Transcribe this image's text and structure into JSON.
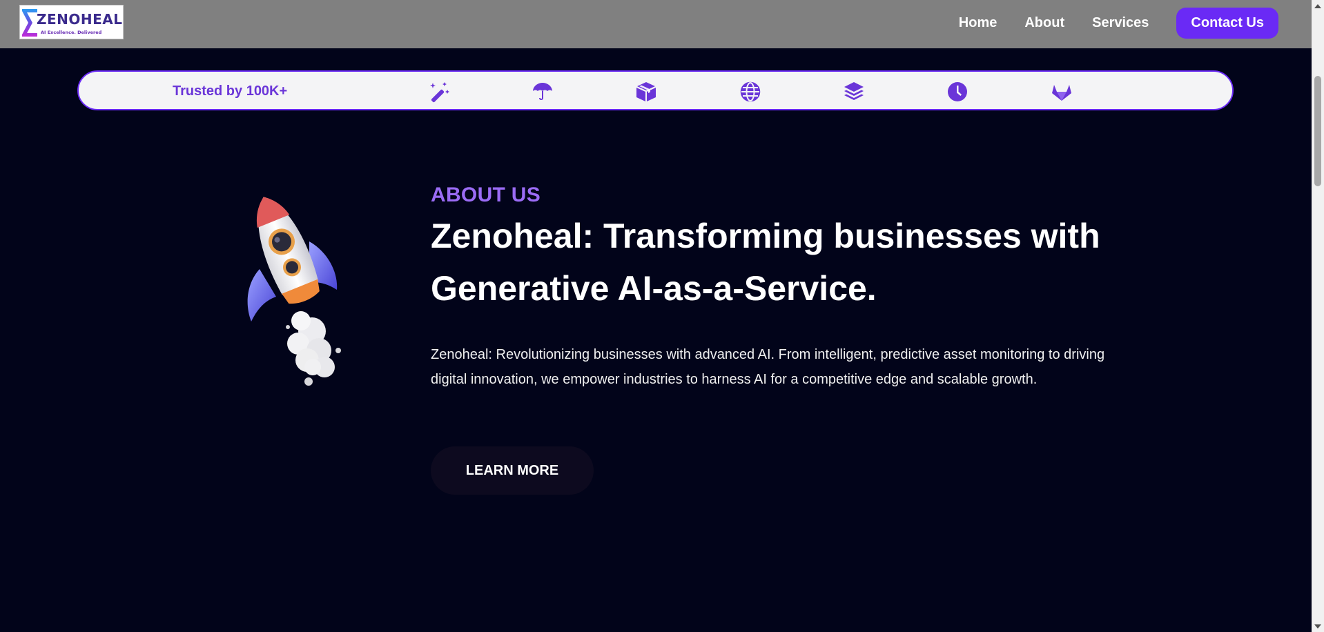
{
  "header": {
    "logo": {
      "brand": "ZENOHEAL",
      "tagline": "AI Excellence. Delivered"
    },
    "nav": [
      {
        "label": "Home"
      },
      {
        "label": "About"
      },
      {
        "label": "Services"
      }
    ],
    "contact_label": "Contact Us"
  },
  "trusted": {
    "text": "Trusted by 100K+",
    "icons": [
      "magic-wand-icon",
      "umbrella-icon",
      "box-icon",
      "globe-icon",
      "layers-icon",
      "clock-icon",
      "gitlab-icon"
    ]
  },
  "hero": {
    "label": "ABOUT US",
    "title": "Zenoheal: Transforming businesses with Generative AI-as-a-Service.",
    "description": "Zenoheal: Revolutionizing businesses with advanced AI. From intelligent, predictive asset monitoring to driving digital innovation, we empower industries to harness AI for a competitive edge and scalable growth.",
    "button_label": "LEARN MORE"
  },
  "colors": {
    "background": "#02041a",
    "header": "#808080",
    "accent": "#6a2af5",
    "label": "#9b6cf5"
  }
}
